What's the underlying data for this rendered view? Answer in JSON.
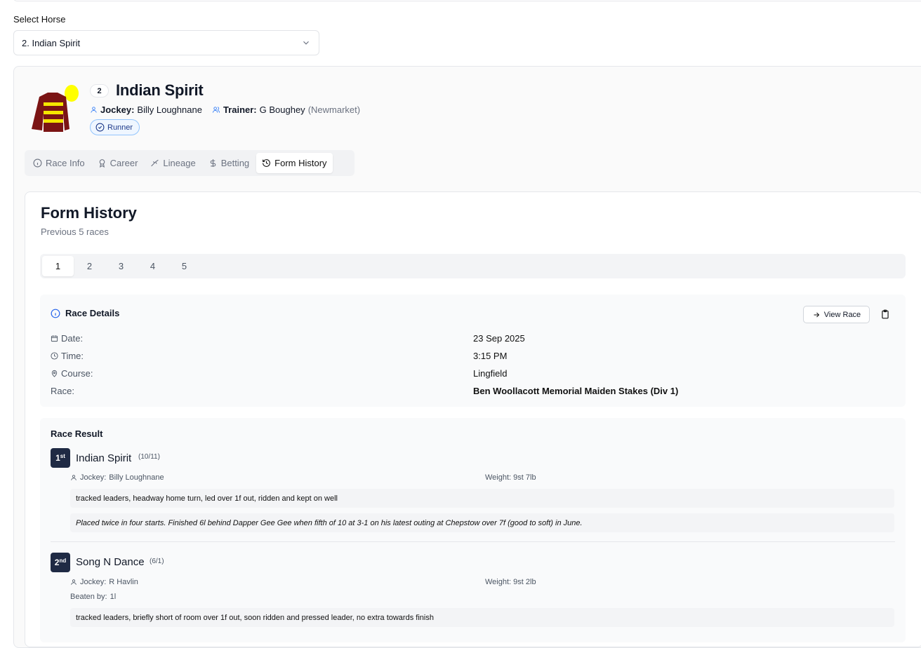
{
  "select": {
    "label": "Select Horse",
    "value": "2. Indian Spirit"
  },
  "horse": {
    "number": "2",
    "name": "Indian Spirit",
    "jockey_label": "Jockey:",
    "jockey": "Billy Loughnane",
    "trainer_label": "Trainer:",
    "trainer": "G Boughey",
    "trainer_location": "(Newmarket)",
    "status": "Runner",
    "silk_colors": {
      "body": "#7b1414",
      "hoops": "#f5e600",
      "cap": "#ffff00"
    }
  },
  "tabs": [
    {
      "label": "Race Info",
      "icon": "info-icon"
    },
    {
      "label": "Career",
      "icon": "award-icon"
    },
    {
      "label": "Lineage",
      "icon": "tree-icon"
    },
    {
      "label": "Betting",
      "icon": "dollar-icon"
    },
    {
      "label": "Form History",
      "icon": "history-icon",
      "active": true
    }
  ],
  "form": {
    "title": "Form History",
    "subtitle": "Previous 5 races",
    "race_tabs": [
      "1",
      "2",
      "3",
      "4",
      "5"
    ],
    "details": {
      "heading": "Race Details",
      "view_race": "View Race",
      "rows": [
        {
          "label": "Date:",
          "value": "23 Sep 2025"
        },
        {
          "label": "Time:",
          "value": "3:15 PM"
        },
        {
          "label": "Course:",
          "value": "Lingfield"
        },
        {
          "label": "Race:",
          "value": "Ben Woollacott Memorial Maiden Stakes (Div 1)"
        }
      ]
    },
    "result": {
      "heading": "Race Result",
      "runners": [
        {
          "pos": "1",
          "pos_suffix": "st",
          "name": "Indian Spirit",
          "odds": "(10/11)",
          "jockey_label": "Jockey:",
          "jockey": "Billy Loughnane",
          "weight_label": "Weight:",
          "weight": "9st 7lb",
          "comment": "tracked leaders, headway home turn, led over 1f out, ridden and kept on well",
          "note": "Placed twice in four starts. Finished 6l behind Dapper Gee Gee when fifth of 10 at 3-1 on his latest outing at Chepstow over 7f (good to soft) in June."
        },
        {
          "pos": "2",
          "pos_suffix": "nd",
          "name": "Song N Dance",
          "odds": "(6/1)",
          "jockey_label": "Jockey:",
          "jockey": "R Havlin",
          "weight_label": "Weight:",
          "weight": "9st 2lb",
          "beaten_label": "Beaten by:",
          "beaten": "1l",
          "comment": "tracked leaders, briefly short of room over 1f out, soon ridden and pressed leader, no extra towards finish"
        }
      ]
    }
  }
}
